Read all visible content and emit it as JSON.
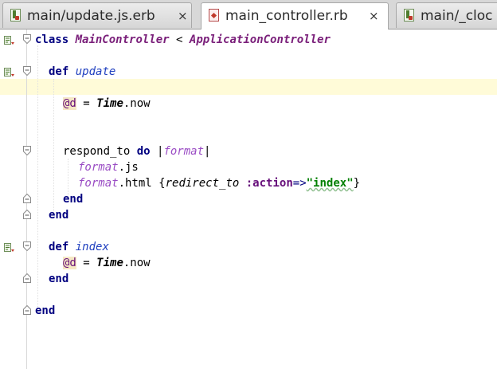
{
  "tabs": [
    {
      "label": "main/update.js.erb",
      "close": "×",
      "icon": "erb-file-icon",
      "active": false
    },
    {
      "label": "main_controller.rb",
      "close": "×",
      "icon": "ruby-file-icon",
      "active": true
    },
    {
      "label": "main/_cloc",
      "close": "",
      "icon": "erb-file-icon",
      "active": false
    }
  ],
  "code": {
    "l1": {
      "kw": "class",
      "cls": "MainController",
      "op": " < ",
      "parent": "ApplicationController"
    },
    "l2": {
      "kw": "def",
      "name": "update"
    },
    "l4": {
      "ivar": "@d",
      "eq": " = ",
      "cls": "Time",
      "rest": ".now"
    },
    "l6": {
      "call": "respond_to ",
      "kw": "do",
      "p1": " |",
      "param": "format",
      "p2": "|"
    },
    "l7": {
      "param": "format",
      "rest": ".js"
    },
    "l8": {
      "param": "format",
      "rest1": ".html {",
      "call": "redirect_to",
      "sp": " ",
      "sym": ":action",
      "arrow": "=>",
      "str": "\"index\"",
      "close": "}"
    },
    "l9": {
      "kw": "end"
    },
    "l10": {
      "kw": "end"
    },
    "l12": {
      "kw": "def",
      "name": "index"
    },
    "l13": {
      "ivar": "@d",
      "eq": " = ",
      "cls": "Time",
      "rest": ".now"
    },
    "l14": {
      "kw": "end"
    },
    "l16": {
      "kw": "end"
    }
  }
}
